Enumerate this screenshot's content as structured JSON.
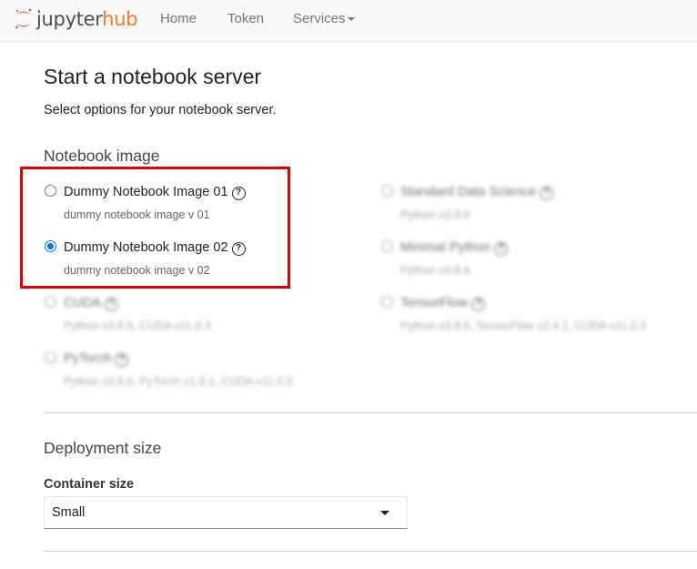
{
  "navbar": {
    "brand_left": "jupyter",
    "brand_right": "hub",
    "links": [
      "Home",
      "Token",
      "Services"
    ]
  },
  "page": {
    "title": "Start a notebook server",
    "subtitle": "Select options for your notebook server."
  },
  "notebook_image": {
    "heading": "Notebook image",
    "options": [
      {
        "title": "Dummy Notebook Image 01",
        "desc": "dummy notebook image v 01",
        "checked": false
      },
      {
        "title": "Dummy Notebook Image 02",
        "desc": "dummy notebook image v 02",
        "checked": true
      },
      {
        "title": "CUDA",
        "desc": "Python v3.8.6, CUDA v11.0.3",
        "checked": false
      },
      {
        "title": "PyTorch",
        "desc": "Python v3.8.6, PyTorch v1.8.1, CUDA v11.0.3",
        "checked": false
      },
      {
        "title": "Standard Data Science",
        "desc": "Python v3.8.6",
        "checked": false
      },
      {
        "title": "Minimal Python",
        "desc": "Python v3.8.6",
        "checked": false
      },
      {
        "title": "TensorFlow",
        "desc": "Python v3.8.6, TensorFlow v2.4.1, CUDA v11.0.3",
        "checked": false
      }
    ]
  },
  "deployment": {
    "heading": "Deployment size",
    "container_label": "Container size",
    "container_value": "Small"
  },
  "colors": {
    "brand_orange": "#f37726",
    "highlight_red": "#e00000",
    "radio_blue": "#0075ff"
  }
}
